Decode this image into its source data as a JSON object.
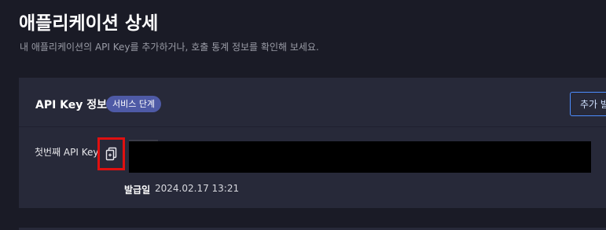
{
  "page": {
    "title": "애플리케이션 상세",
    "subtitle": "내 애플리케이션의 API Key를 추가하거나, 호출 통계 정보를 확인해 보세요."
  },
  "api_key_card": {
    "title": "API Key 정보",
    "badge": "서비스 단계",
    "add_button_label": "추가 발",
    "key": {
      "label": "첫번째 API Key",
      "issued_label": "발급일",
      "issued_date": "2024.02.17 13:21"
    }
  },
  "icons": {
    "copy": "copy-icon"
  },
  "colors": {
    "background": "#1a1b26",
    "card": "#272939",
    "badge": "#4e5aa6",
    "button_border": "#4c8dff",
    "highlight": "#e01010"
  }
}
